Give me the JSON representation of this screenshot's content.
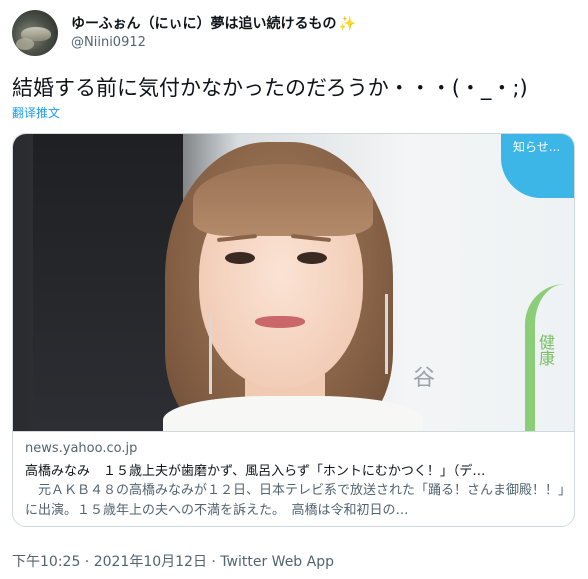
{
  "user": {
    "display_name": "ゆーふぉん（にぃに）夢は追い続けるもの",
    "sparkle": "✨",
    "handle": "@Niini0912"
  },
  "tweet": {
    "text": "結婚する前に気付かなかったのだろうか・・・(・_・;)",
    "translate_label": "翻译推文"
  },
  "card": {
    "domain": "news.yahoo.co.jp",
    "title": "高橋みなみ　１５歳上夫が歯磨かず、風呂入らず「ホントにむかつく！」（デ…",
    "description": "　元ＡＫＢ４８の高橋みなみが１２日、日本テレビ系で放送された「踊る！さんま御殿！！」に出演。１５歳年上の夫への不満を訴えた。　高橋は令和初日の…",
    "image_bg_text_top": "知らせ...",
    "image_bg_text_side": "健康",
    "image_bg_text_mid": "谷"
  },
  "meta": {
    "timestamp": "下午10:25 · 2021年10月12日 · Twitter Web App"
  }
}
